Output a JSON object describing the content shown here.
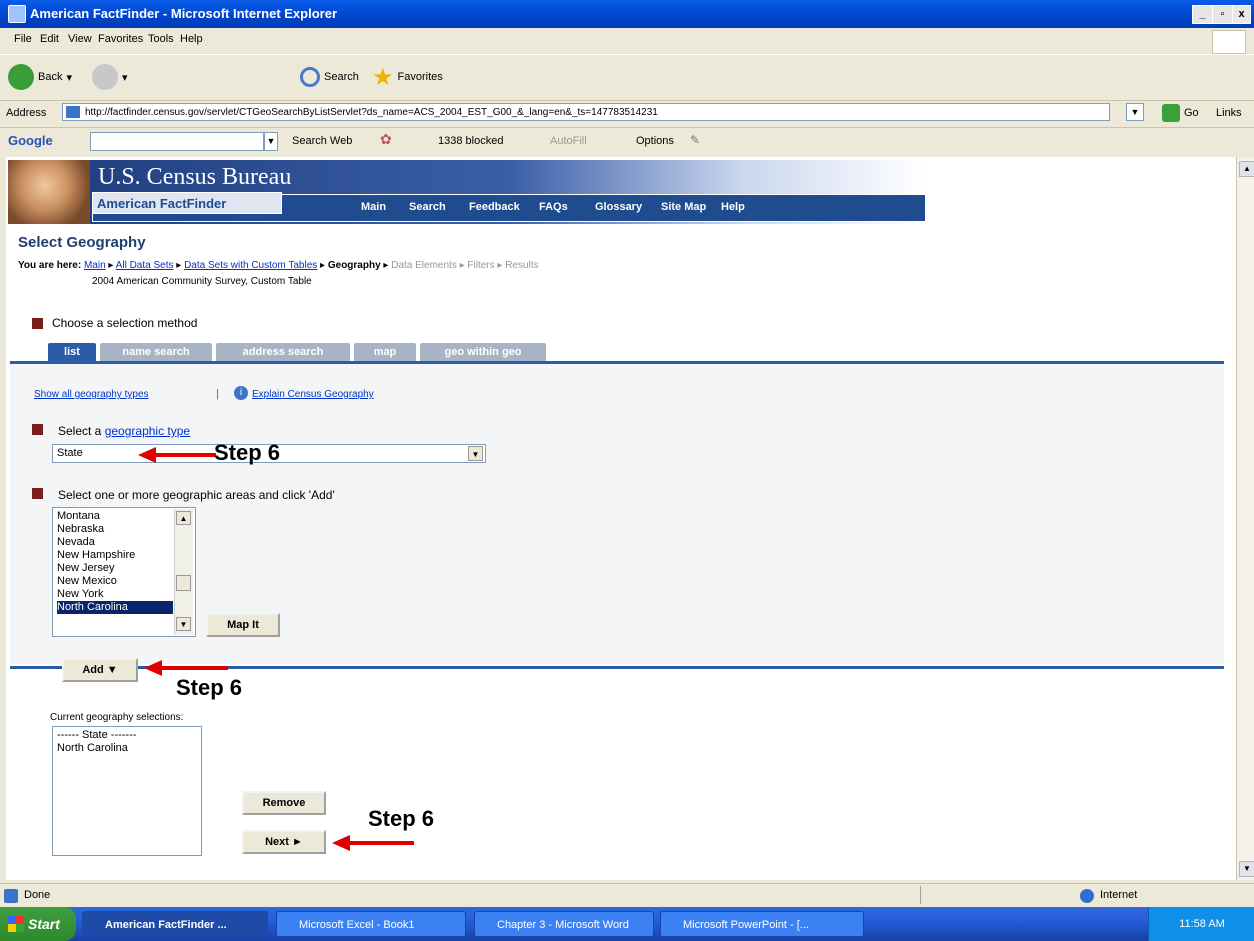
{
  "window": {
    "title": "American FactFinder - Microsoft Internet Explorer"
  },
  "menu": [
    "File",
    "Edit",
    "View",
    "Favorites",
    "Tools",
    "Help"
  ],
  "toolbar": {
    "back": "Back",
    "search": "Search",
    "favorites": "Favorites"
  },
  "address": {
    "label": "Address",
    "url": "http://factfinder.census.gov/servlet/CTGeoSearchByListServlet?ds_name=ACS_2004_EST_G00_&_lang=en&_ts=147783514231",
    "go": "Go",
    "links": "Links"
  },
  "google": {
    "logo": "Google",
    "search_web": "Search Web",
    "blocked": "1338 blocked",
    "autofill": "AutoFill",
    "options": "Options"
  },
  "site": {
    "bureau": "U.S. Census Bureau",
    "factfinder": "American FactFinder",
    "nav": [
      "Main",
      "Search",
      "Feedback",
      "FAQs",
      "Glossary",
      "Site Map",
      "Help"
    ]
  },
  "page": {
    "title": "Select Geography",
    "you_are_here": "You are here:",
    "breadcrumb": {
      "main": "Main",
      "all": "All Data Sets",
      "custom": "Data Sets with Custom Tables",
      "geo": "Geography",
      "rest": "Data Elements ▸ Filters ▸ Results"
    },
    "dataset": "2004 American Community Survey, Custom Table",
    "choose": "Choose a selection method",
    "tabs": [
      "list",
      "name search",
      "address search",
      "map",
      "geo within geo"
    ],
    "show_all": "Show all geography types",
    "explain": "Explain Census Geography",
    "select_type_prefix": "Select a ",
    "select_type_link": "geographic type",
    "geo_type_value": "State",
    "select_areas": "Select one or more geographic areas and click 'Add'",
    "areas": [
      "Montana",
      "Nebraska",
      "Nevada",
      "New Hampshire",
      "New Jersey",
      "New Mexico",
      "New York",
      "North Carolina"
    ],
    "selected_area": "North Carolina",
    "map_it": "Map It",
    "add": "Add ▼",
    "current_label": "Current geography selections:",
    "current": [
      "------ State -------",
      "North Carolina"
    ],
    "remove": "Remove",
    "next": "Next ►"
  },
  "annotations": {
    "step": "Step 6"
  },
  "status": {
    "done": "Done",
    "zone": "Internet"
  },
  "taskbar": {
    "start": "Start",
    "tasks": [
      "American FactFinder ...",
      "Microsoft Excel - Book1",
      "Chapter 3 - Microsoft Word",
      "Microsoft PowerPoint - [..."
    ],
    "clock": "11:58 AM"
  }
}
